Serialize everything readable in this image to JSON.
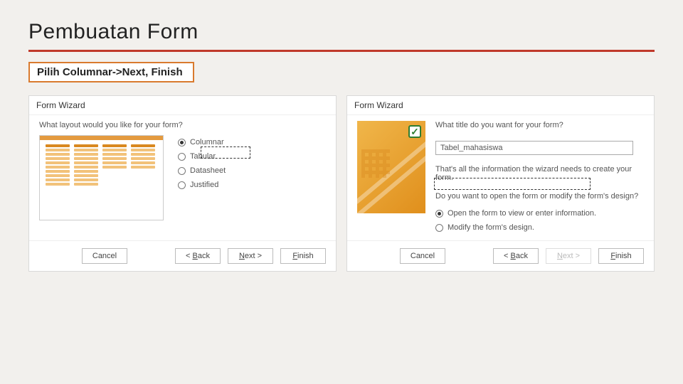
{
  "slide": {
    "title": "Pembuatan Form",
    "callout": "Pilih Columnar->Next, Finish"
  },
  "wizard1": {
    "title": "Form Wizard",
    "prompt": "What layout would you like for your form?",
    "options": {
      "columnar": "Columnar",
      "tabular": "Tabular",
      "datasheet": "Datasheet",
      "justified": "Justified"
    },
    "selected": "columnar",
    "buttons": {
      "cancel": "Cancel",
      "back": "< Back",
      "next": "Next >",
      "finish": "Finish"
    }
  },
  "wizard2": {
    "title": "Form Wizard",
    "prompt": "What title do you want for your form?",
    "title_input": "Tabel_mahasiswa",
    "info1": "That's all the information the wizard needs to create your form.",
    "info2": "Do you want to open the form or modify the form's design?",
    "options": {
      "open": "Open the form to view or enter information.",
      "modify": "Modify the form's design."
    },
    "selected": "open",
    "buttons": {
      "cancel": "Cancel",
      "back": "< Back",
      "next": "Next >",
      "finish": "Finish"
    }
  }
}
